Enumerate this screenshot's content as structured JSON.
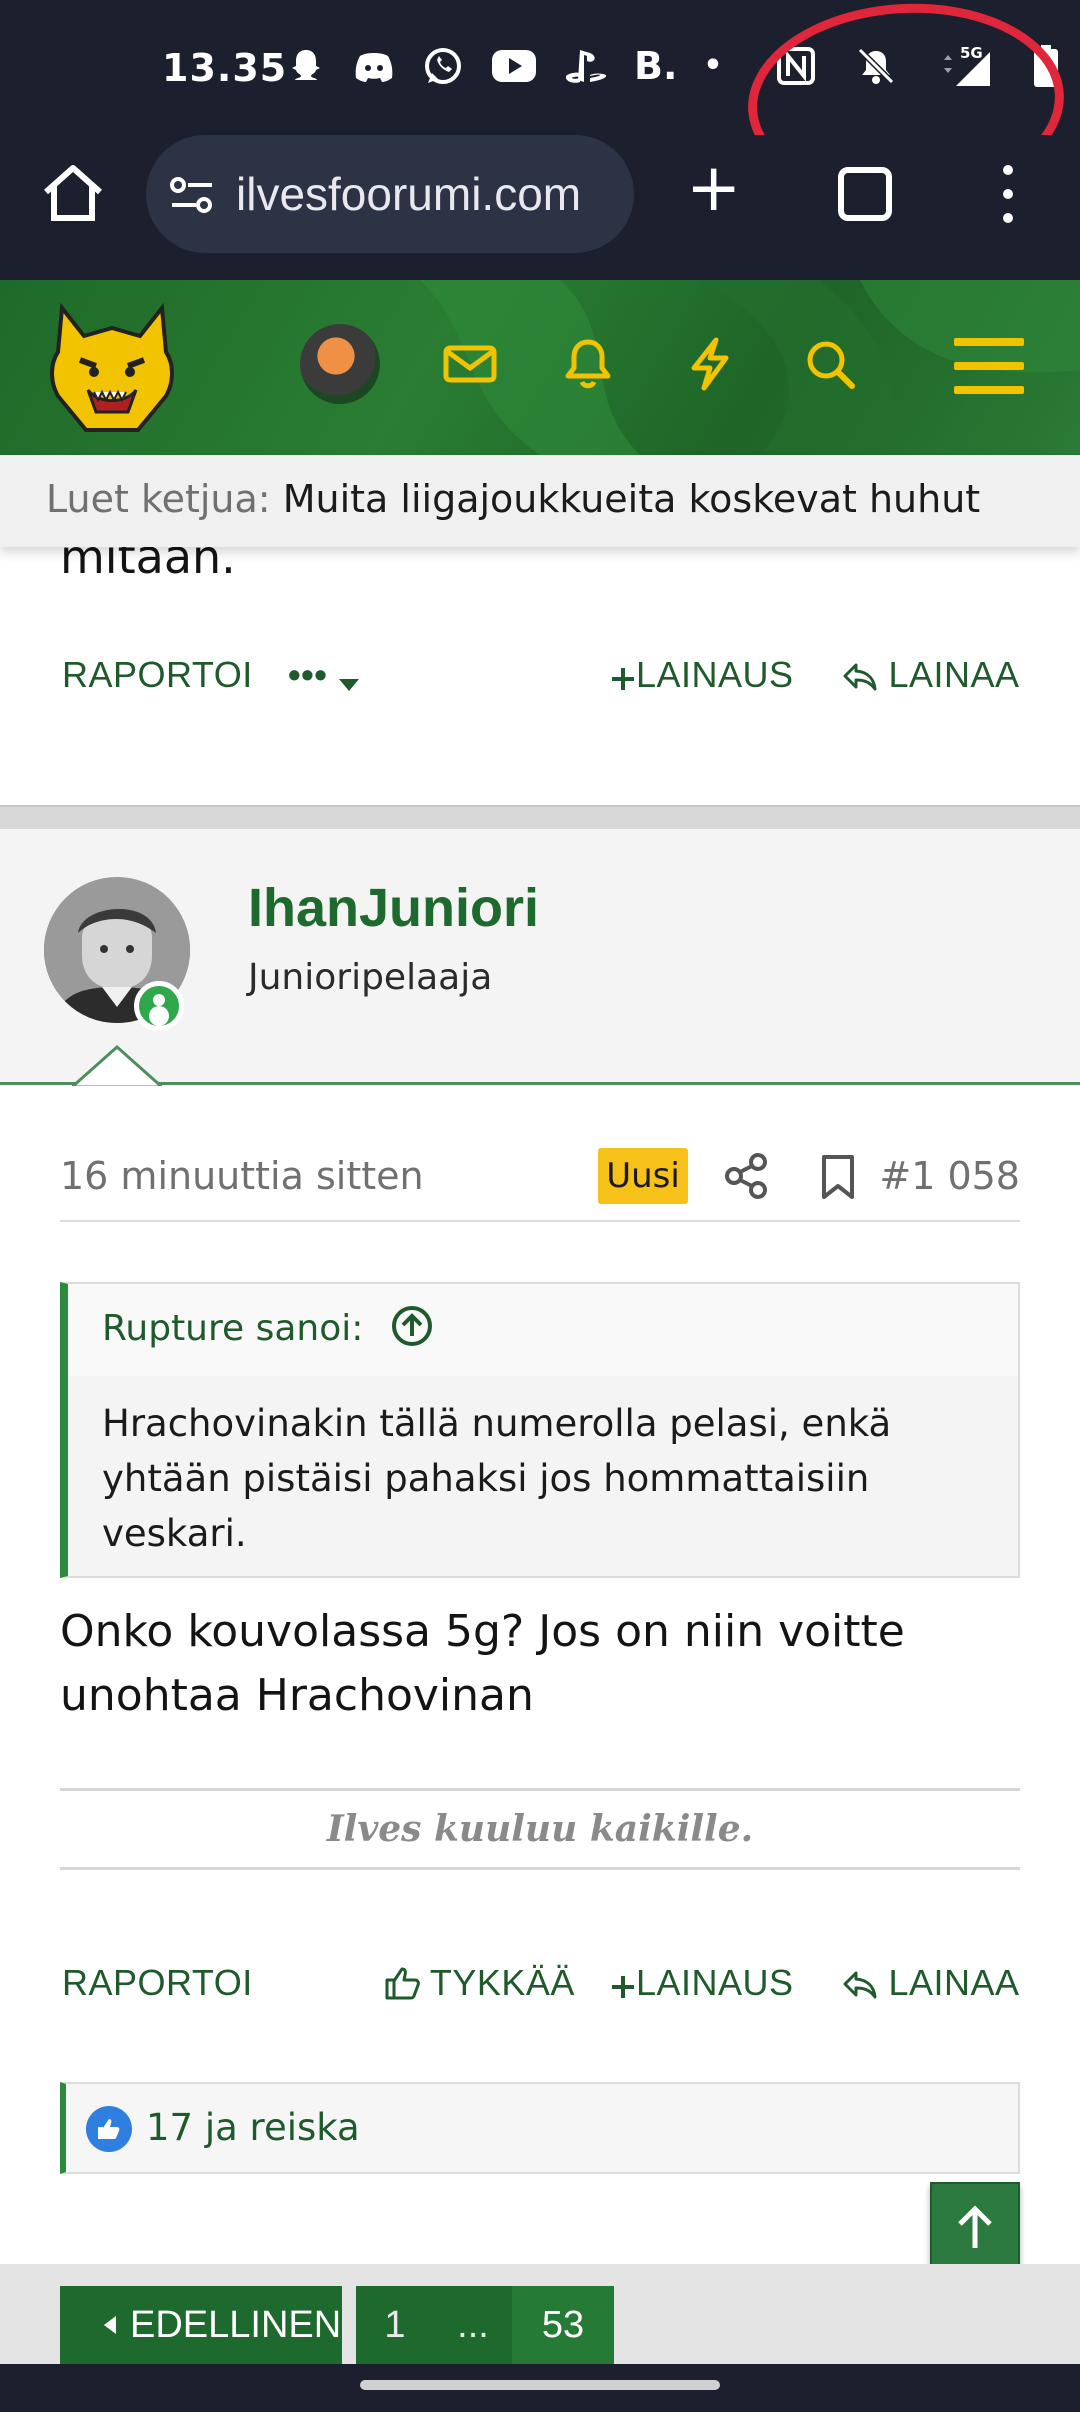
{
  "status_bar": {
    "time": "13.35",
    "app_icons": [
      "snapchat-icon",
      "discord-icon",
      "whatsapp-icon",
      "youtube-icon",
      "playstation-icon",
      "b-icon",
      "dot-icon"
    ],
    "b_glyph": "B.",
    "dot_glyph": "•",
    "network": "5G"
  },
  "browser": {
    "url": "ilvesfoorumi.com",
    "new_tab": "+"
  },
  "reading_bar": {
    "prefix": "Luet ketjua:",
    "thread": "Muita liigajoukkueita koskevat huhut"
  },
  "previous_post": {
    "clipped_text": "mitään.",
    "actions": {
      "report": "RAPORTOI",
      "more": "•••",
      "multiquote": "LAINAUS",
      "reply": "LAINAA"
    }
  },
  "post": {
    "username": "IhanJuniori",
    "user_title": "Junioripelaaja",
    "time": "16 minuuttia sitten",
    "badge": "Uusi",
    "number": "#1 058",
    "quote": {
      "author": "Rupture sanoi:",
      "text": "Hrachovinakin tällä numerolla pelasi, enkä yhtään pistäisi pahaksi jos hommattaisiin veskari."
    },
    "body": "Onko kouvolassa 5g? Jos on niin voitte unohtaa Hrachovinan",
    "signature": "Ilves kuuluu kaikille.",
    "actions": {
      "report": "RAPORTOI",
      "like": "TYKKÄÄ",
      "multiquote": "LAINAUS",
      "reply": "LAINAA"
    },
    "reactions": "17 ja reiska"
  },
  "pagination": {
    "prev": "EDELLINEN",
    "first": "1",
    "ellipsis": "...",
    "current": "53"
  },
  "colors": {
    "forum_green": "#1e6a2e",
    "accent_yellow": "#f2c300",
    "badge_yellow": "#f6c21a",
    "status_bar": "#1b1f2e",
    "annotation_red": "#e0263a"
  }
}
